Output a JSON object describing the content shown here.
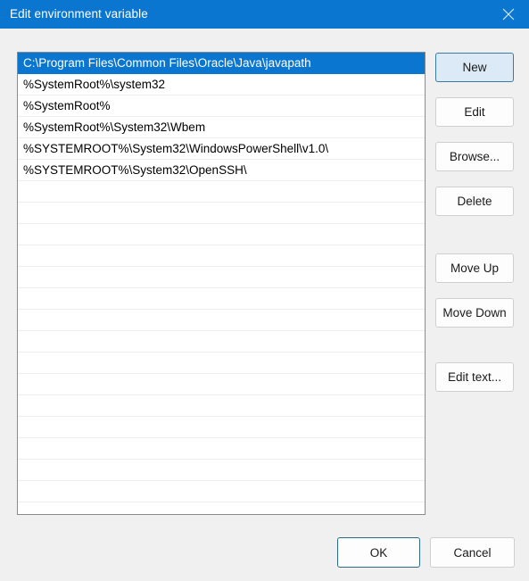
{
  "window": {
    "title": "Edit environment variable",
    "close_icon": "close-x-icon",
    "titlebar_color": "#0a76d0",
    "background_color": "#f0f0f0"
  },
  "list": {
    "selection_color": "#0a76d0",
    "selected_index": 0,
    "items": [
      "C:\\Program Files\\Common Files\\Oracle\\Java\\javapath",
      "%SystemRoot%\\system32",
      "%SystemRoot%",
      "%SystemRoot%\\System32\\Wbem",
      "%SYSTEMROOT%\\System32\\WindowsPowerShell\\v1.0\\",
      "%SYSTEMROOT%\\System32\\OpenSSH\\"
    ],
    "empty_row_count": 15
  },
  "side_buttons": {
    "new": "New",
    "edit": "Edit",
    "browse": "Browse...",
    "delete": "Delete",
    "move_up": "Move Up",
    "move_down": "Move Down",
    "edit_text": "Edit text..."
  },
  "footer": {
    "ok": "OK",
    "cancel": "Cancel"
  }
}
